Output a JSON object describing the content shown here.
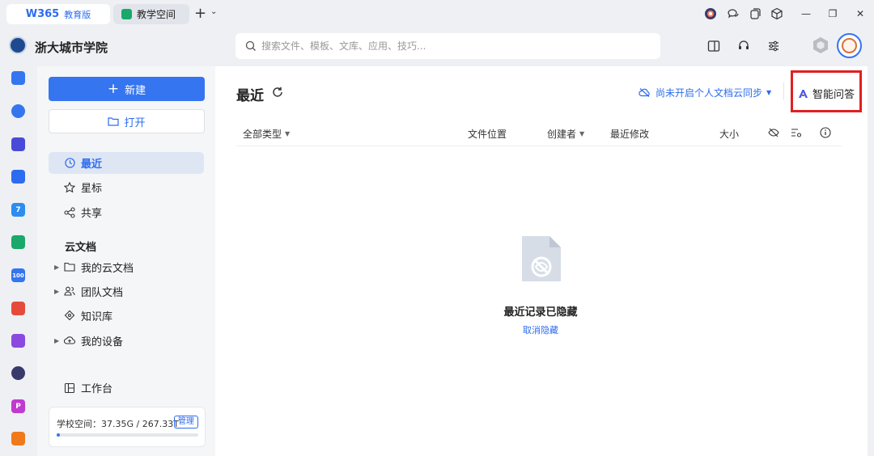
{
  "tabs": [
    {
      "logo": "W365",
      "label": "教育版"
    },
    {
      "label": "教学空间"
    }
  ],
  "tab_controls": {
    "add": "+",
    "dropdown": "⌄"
  },
  "window_controls": {
    "minimize": "—",
    "restore": "❐",
    "close": "✕"
  },
  "school": {
    "name": "浙大城市学院"
  },
  "search": {
    "placeholder": "搜索文件、模板、文库、应用、技巧..."
  },
  "nav": {
    "new_label": "新建",
    "open_label": "打开",
    "items": [
      {
        "label": "最近",
        "icon": "clock-icon"
      },
      {
        "label": "星标",
        "icon": "star-icon"
      },
      {
        "label": "共享",
        "icon": "share-icon"
      }
    ],
    "section_title": "云文档",
    "tree": [
      {
        "label": "我的云文档",
        "icon": "folder-icon",
        "expandable": true
      },
      {
        "label": "团队文档",
        "icon": "team-icon",
        "expandable": true
      },
      {
        "label": "知识库",
        "icon": "knowledge-icon",
        "expandable": false
      },
      {
        "label": "我的设备",
        "icon": "device-icon",
        "expandable": true
      }
    ],
    "workbench_label": "工作台",
    "storage": {
      "label": "学校空间：37.35G / 267.33T",
      "manage": "管理",
      "used_fraction": 0.0014
    }
  },
  "main": {
    "title": "最近",
    "sync_status": "尚未开启个人文档云同步",
    "ai_button": "智能问答",
    "columns": {
      "type": "全部类型",
      "location": "文件位置",
      "creator": "创建者",
      "modified": "最近修改",
      "size": "大小"
    },
    "empty": {
      "title": "最近记录已隐藏",
      "action": "取消隐藏"
    }
  },
  "colors": {
    "accent": "#3575f0",
    "highlight_box": "#e02020"
  }
}
